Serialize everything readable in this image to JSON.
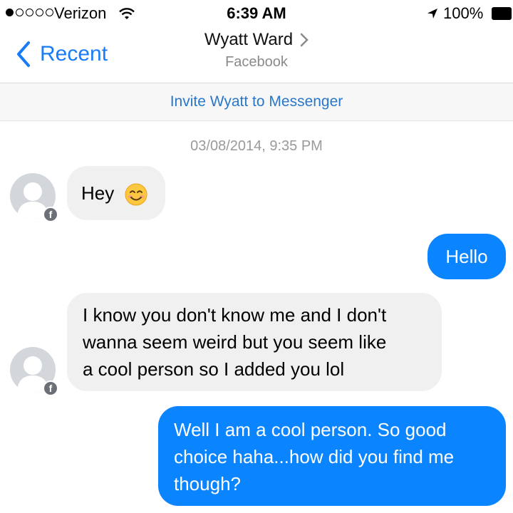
{
  "status_bar": {
    "carrier": "Verizon",
    "time": "6:39 AM",
    "battery": "100%",
    "icons": [
      "signal-dots-icon",
      "wifi-icon",
      "location-arrow-icon",
      "battery-icon"
    ]
  },
  "nav": {
    "back_label": "Recent",
    "contact_name": "Wyatt Ward",
    "contact_source": "Facebook"
  },
  "invite": {
    "label": "Invite Wyatt to Messenger"
  },
  "conversation": {
    "timestamp": "03/08/2014, 9:35 PM",
    "messages": [
      {
        "direction": "incoming",
        "text": "Hey",
        "emoji": "smiling-face-icon"
      },
      {
        "direction": "outgoing",
        "text": "Hello"
      },
      {
        "direction": "incoming",
        "lines": [
          "I know you don't know me and I don't",
          "wanna seem weird  but you seem like",
          "a cool person so I added you lol"
        ]
      },
      {
        "direction": "outgoing",
        "lines": [
          "Well I am a cool person. So good",
          "choice haha...how did you find me",
          "though?"
        ]
      }
    ]
  },
  "colors": {
    "accent_blue": "#1a7cf5",
    "outgoing_bubble": "#0a84ff",
    "incoming_bubble": "#f1f0f0",
    "invite_text": "#2a77c8"
  }
}
